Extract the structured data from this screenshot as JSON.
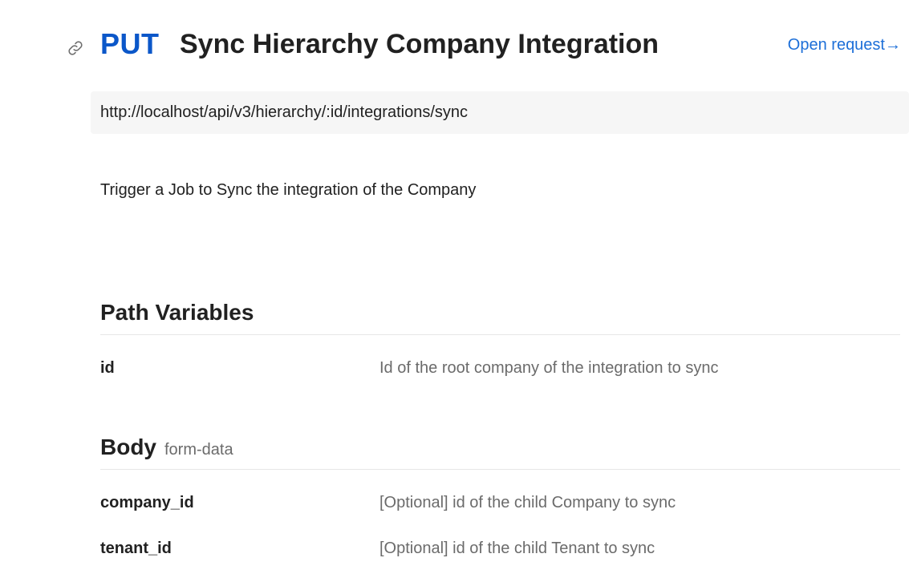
{
  "header": {
    "method": "PUT",
    "title": "Sync Hierarchy Company Integration",
    "open_request": "Open request→",
    "link_icon": "link-icon"
  },
  "request": {
    "url": "http://localhost/api/v3/hierarchy/:id/integrations/sync",
    "description": "Trigger a Job to Sync the integration of the Company"
  },
  "path_variables": {
    "title": "Path Variables",
    "items": [
      {
        "name": "id",
        "description": "Id of the root company of the integration to sync"
      }
    ]
  },
  "body": {
    "title": "Body",
    "type": "form-data",
    "items": [
      {
        "name": "company_id",
        "description": "[Optional] id of the child Company to sync"
      },
      {
        "name": "tenant_id",
        "description": "[Optional] id of the child Tenant to sync"
      }
    ]
  },
  "colors": {
    "method": "#0b57c9",
    "link": "#1d6fd8",
    "muted_text": "#6b6b6b",
    "url_background": "#f6f6f6"
  }
}
